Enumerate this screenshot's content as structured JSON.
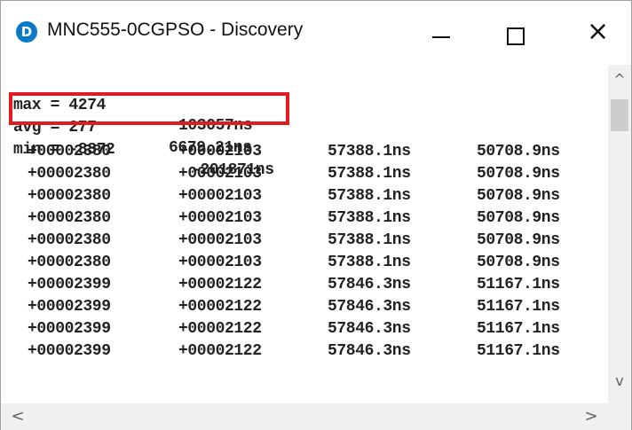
{
  "window": {
    "title": "MNC555-0CGPSO - Discovery",
    "icon_letter": "D",
    "accent_color": "#0a79c6",
    "highlight_color": "#e11b22"
  },
  "controls": {
    "minimize_glyph": "—",
    "close_glyph": "×"
  },
  "stats": {
    "max": {
      "label": "max = 4274",
      "value": "103057ns"
    },
    "avg": {
      "label": "avg = 277",
      "value": "6679.21ns"
    },
    "min": {
      "label": "min = -8372",
      "value": "-201871ns"
    }
  },
  "rows": [
    [
      "+00002380",
      "+00002103",
      "57388.1ns",
      "50708.9ns"
    ],
    [
      "+00002380",
      "+00002103",
      "57388.1ns",
      "50708.9ns"
    ],
    [
      "+00002380",
      "+00002103",
      "57388.1ns",
      "50708.9ns"
    ],
    [
      "+00002380",
      "+00002103",
      "57388.1ns",
      "50708.9ns"
    ],
    [
      "+00002380",
      "+00002103",
      "57388.1ns",
      "50708.9ns"
    ],
    [
      "+00002380",
      "+00002103",
      "57388.1ns",
      "50708.9ns"
    ],
    [
      "+00002399",
      "+00002122",
      "57846.3ns",
      "51167.1ns"
    ],
    [
      "+00002399",
      "+00002122",
      "57846.3ns",
      "51167.1ns"
    ],
    [
      "+00002399",
      "+00002122",
      "57846.3ns",
      "51167.1ns"
    ],
    [
      "+00002399",
      "+00002122",
      "57846.3ns",
      "51167.1ns"
    ]
  ],
  "scrollbar": {
    "up_glyph": "^",
    "down_glyph": "v",
    "left_glyph": "<",
    "right_glyph": ">"
  }
}
